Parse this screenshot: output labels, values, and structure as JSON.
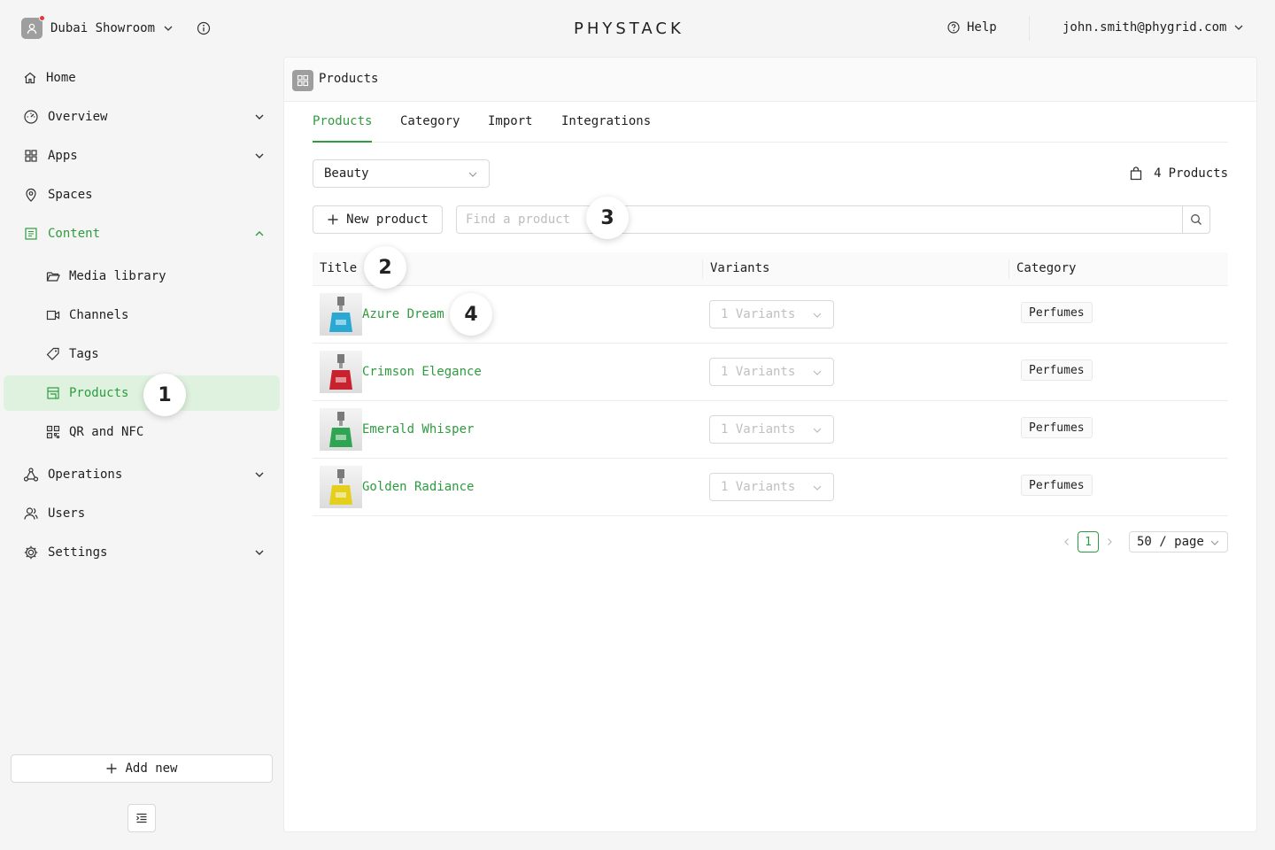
{
  "workspace": {
    "name": "Dubai Showroom"
  },
  "header": {
    "brand": "PHYSTACK",
    "help": "Help",
    "account": "john.smith@phygrid.com"
  },
  "sidebar": {
    "home": "Home",
    "overview": "Overview",
    "apps": "Apps",
    "spaces": "Spaces",
    "content": "Content",
    "media_library": "Media library",
    "channels": "Channels",
    "tags": "Tags",
    "products": "Products",
    "qr_nfc": "QR and NFC",
    "operations": "Operations",
    "users": "Users",
    "settings": "Settings",
    "add_new": "Add new"
  },
  "page": {
    "title": "Products",
    "tabs": [
      "Products",
      "Category",
      "Import",
      "Integrations"
    ],
    "filter_value": "Beauty",
    "product_count": "4",
    "product_count_label": "Products",
    "new_button": "New product",
    "search_placeholder": "Find a product"
  },
  "table": {
    "columns": [
      "Title",
      "Variants",
      "Category"
    ],
    "rows": [
      {
        "title": "Azure Dream",
        "variants": "1 Variants",
        "category": "Perfumes",
        "color": "#29a8d4"
      },
      {
        "title": "Crimson Elegance",
        "variants": "1 Variants",
        "category": "Perfumes",
        "color": "#c8222e"
      },
      {
        "title": "Emerald Whisper",
        "variants": "1 Variants",
        "category": "Perfumes",
        "color": "#2fa553"
      },
      {
        "title": "Golden Radiance",
        "variants": "1 Variants",
        "category": "Perfumes",
        "color": "#e3cf1c"
      }
    ]
  },
  "pagination": {
    "current": "1",
    "page_size": "50 / page"
  },
  "callouts": [
    "1",
    "2",
    "3",
    "4"
  ],
  "colors": {
    "accent": "#2e9b3f",
    "active_bg": "#dff2df"
  }
}
